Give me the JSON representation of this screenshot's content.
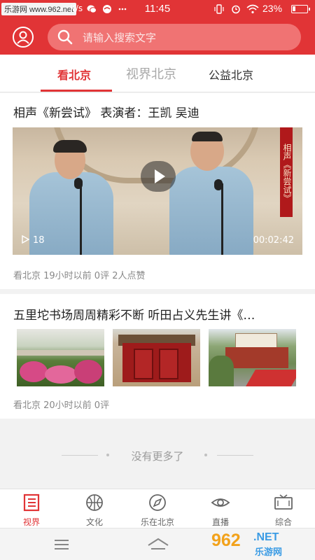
{
  "statusbar": {
    "site_label": "乐游网 www.962.net",
    "fragment": "K/s",
    "time": "11:45",
    "battery_text": "23%",
    "battery_level": 0.23
  },
  "header": {
    "search_placeholder": "请输入搜索文字",
    "brand_color": "#e13436"
  },
  "tabs": [
    {
      "label": "看北京",
      "active": true
    },
    {
      "label": "视界北京",
      "active": false
    },
    {
      "label": "公益北京",
      "active": false
    }
  ],
  "feed": [
    {
      "title": "相声《新尝试》  表演者：王凯 吴迪",
      "banner_text": "相声《新尝试》",
      "play_count": "18",
      "duration": "00:02:42",
      "meta": "看北京   19小时以前   0评   2人点赞"
    },
    {
      "title": "五里坨书场周周精彩不断 听田占义先生讲《…",
      "meta": "看北京   20小时以前   0评"
    }
  ],
  "no_more": "没有更多了",
  "bottom_nav": [
    {
      "label": "视界",
      "icon": "book-icon",
      "active": true
    },
    {
      "label": "文化",
      "icon": "basketball-icon",
      "active": false
    },
    {
      "label": "乐在北京",
      "icon": "compass-icon",
      "active": false
    },
    {
      "label": "直播",
      "icon": "eye-icon",
      "active": false
    },
    {
      "label": "综合",
      "icon": "tv-icon",
      "active": false
    }
  ],
  "watermark": {
    "big": "962",
    "net": ".NET",
    "cn": "乐游网"
  }
}
